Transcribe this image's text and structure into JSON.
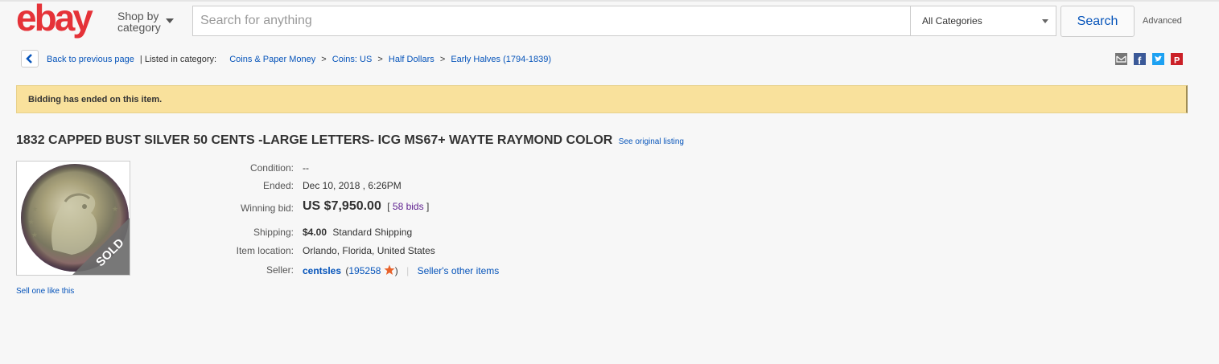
{
  "header": {
    "logo_text": "ebay",
    "shop_by_category_line1": "Shop by",
    "shop_by_category_line2": "category",
    "search_placeholder": "Search for anything",
    "category_select": "All Categories",
    "search_button": "Search",
    "advanced_link": "Advanced"
  },
  "breadcrumb": {
    "back_label": "Back to previous page",
    "listed_in": "| Listed in category:",
    "items": [
      "Coins & Paper Money",
      "Coins: US",
      "Half Dollars",
      "Early Halves (1794-1839)"
    ],
    "separator": ">"
  },
  "social_icons": [
    "email-icon",
    "facebook-icon",
    "twitter-icon",
    "pinterest-icon"
  ],
  "banner": {
    "message": "Bidding has ended on this item."
  },
  "listing": {
    "title": "1832 CAPPED BUST SILVER 50 CENTS -LARGE LETTERS- ICG MS67+ WAYTE RAYMOND COLOR",
    "see_original": "See original listing",
    "sold_badge": "SOLD",
    "sell_one_like_this": "Sell one like this"
  },
  "details": {
    "condition_label": "Condition:",
    "condition_value": "--",
    "ended_label": "Ended:",
    "ended_value": "Dec 10, 2018 , 6:26PM",
    "winning_bid_label": "Winning bid:",
    "winning_bid_value": "US $7,950.00",
    "bids_open": "[",
    "bids_value": "58 bids",
    "bids_close": "]",
    "shipping_label": "Shipping:",
    "shipping_cost": "$4.00",
    "shipping_method": "Standard Shipping",
    "location_label": "Item location:",
    "location_value": "Orlando, Florida, United States",
    "seller_label": "Seller:",
    "seller_name": "centsles",
    "seller_feedback_open": "(",
    "seller_feedback": "195258",
    "seller_feedback_close": ")",
    "seller_divider": "|",
    "seller_other_items": "Seller's other items"
  },
  "colors": {
    "ebay_red": "#e53238",
    "ebay_blue": "#0064d2",
    "ebay_yellow": "#f5af02",
    "ebay_green": "#86b817",
    "link_blue": "#0654ba",
    "banner_bg": "#f9e19c"
  }
}
